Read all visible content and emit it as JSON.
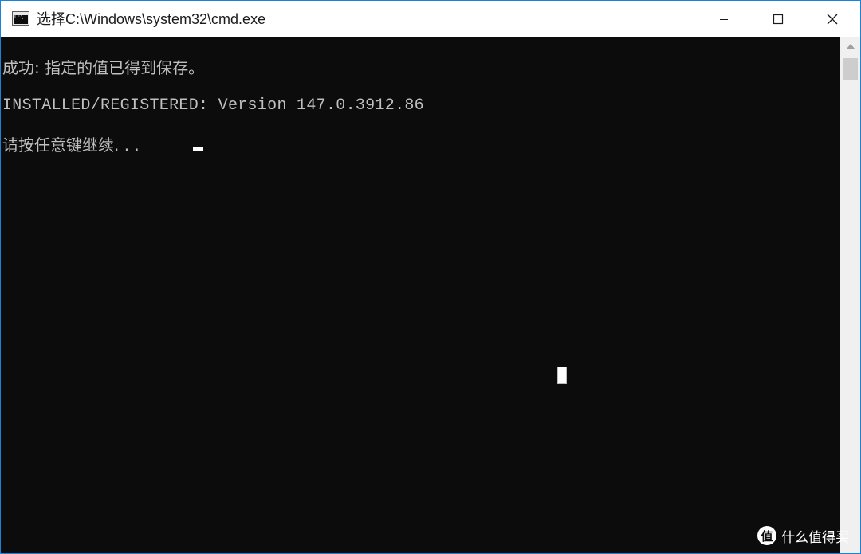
{
  "window": {
    "title": "选择C:\\Windows\\system32\\cmd.exe",
    "icon": "cmd-icon",
    "icon_text": "C:\\."
  },
  "controls": {
    "minimize_icon": "minimize-icon",
    "maximize_icon": "maximize-icon",
    "close_icon": "close-icon"
  },
  "console": {
    "lines": [
      "成功: 指定的值已得到保存。",
      "INSTALLED/REGISTERED: Version 147.0.3912.86",
      "请按任意键继续. . . "
    ],
    "text_color": "#c0c0c0",
    "background_color": "#0c0c0c"
  },
  "scrollbar": {
    "up_arrow_icon": "scroll-up-icon"
  },
  "watermark": {
    "logo_glyph": "值",
    "text": "什么值得买"
  },
  "colors": {
    "border": "#1883d7",
    "titlebar": "#ffffff",
    "scrollbar": "#f0f0f0",
    "thumb": "#cdcdcd"
  }
}
